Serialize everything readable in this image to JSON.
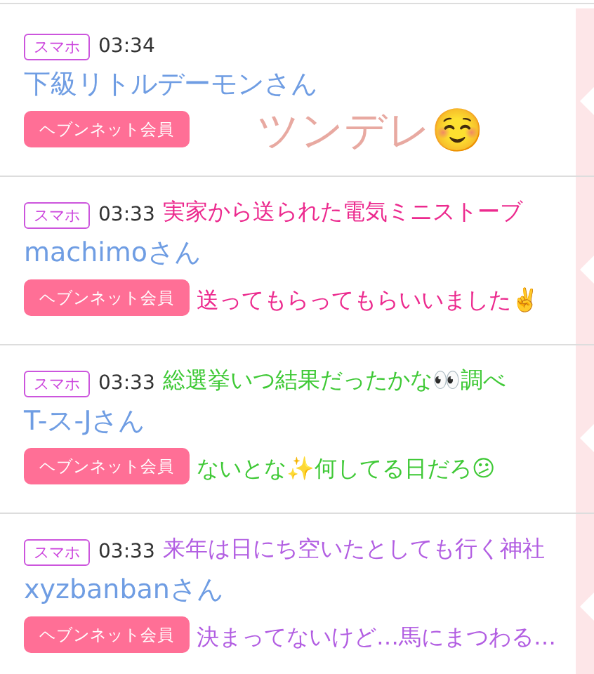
{
  "posts": [
    {
      "device": "スマホ",
      "time": "03:34",
      "name": "下級リトルデーモンさん",
      "member_label": "ヘブンネット会員",
      "caption": {
        "color": "#e8a9a1",
        "lines": [
          "ツンデレ☺️"
        ]
      }
    },
    {
      "device": "スマホ",
      "time": "03:33",
      "name": "machimoさん",
      "member_label": "ヘブンネット会員",
      "caption": {
        "color": "#ec2a8e",
        "lines": [
          "実家から送られた電気ミニストーブ",
          "送ってもらってもらいいました✌️"
        ]
      }
    },
    {
      "device": "スマホ",
      "time": "03:33",
      "name": "T-ス-Jさん",
      "member_label": "ヘブンネット会員",
      "caption": {
        "color": "#3fc936",
        "lines": [
          "総選挙いつ結果だったかな👀調べ",
          "ないとな✨何してる日だろ😕"
        ]
      }
    },
    {
      "device": "スマホ",
      "time": "03:33",
      "name": "xyzbanbanさん",
      "member_label": "ヘブンネット会員",
      "caption": {
        "color": "#b25ee2",
        "lines": [
          "来年は日にち空いたとしても行く神社",
          "決まってないけど…馬にまつわる…"
        ]
      }
    }
  ]
}
